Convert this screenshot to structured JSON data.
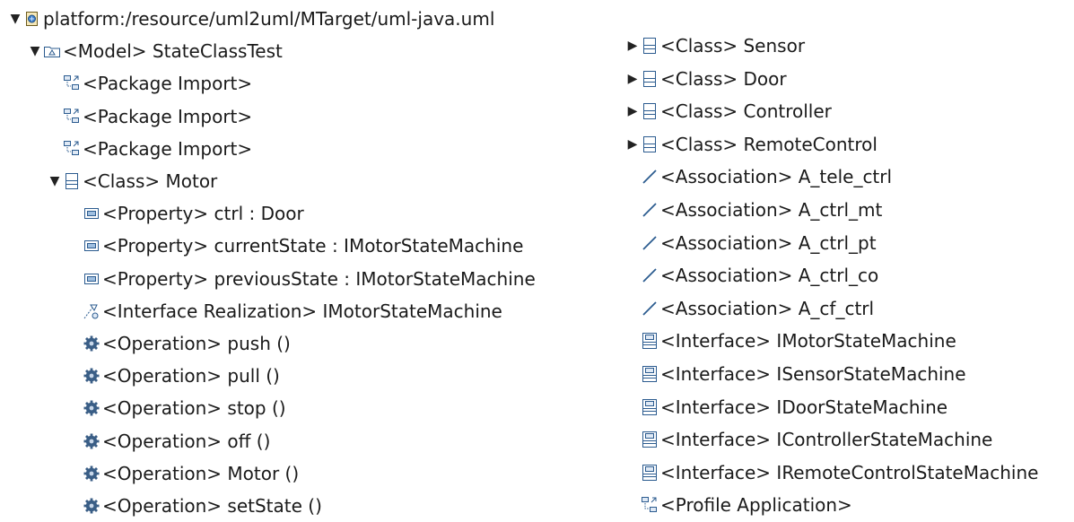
{
  "left_tree": [
    {
      "label": "platform:/resource/uml2uml/MTarget/uml-java.uml",
      "icon": "resource-icon",
      "twisty": "expanded",
      "level": 0
    },
    {
      "label": "<Model> StateClassTest",
      "icon": "model-icon",
      "twisty": "expanded",
      "level": 1
    },
    {
      "label": "<Package Import>",
      "icon": "package-import-icon",
      "twisty": "none",
      "level": 2
    },
    {
      "label": "<Package Import>",
      "icon": "package-import-icon",
      "twisty": "none",
      "level": 2
    },
    {
      "label": "<Package Import>",
      "icon": "package-import-icon",
      "twisty": "none",
      "level": 2
    },
    {
      "label": "<Class> Motor",
      "icon": "class-icon",
      "twisty": "expanded",
      "level": 2
    },
    {
      "label": "<Property> ctrl : Door",
      "icon": "property-icon",
      "twisty": "none",
      "level": 3
    },
    {
      "label": "<Property> currentState : IMotorStateMachine",
      "icon": "property-icon",
      "twisty": "none",
      "level": 3
    },
    {
      "label": "<Property> previousState : IMotorStateMachine",
      "icon": "property-icon",
      "twisty": "none",
      "level": 3
    },
    {
      "label": "<Interface Realization> IMotorStateMachine",
      "icon": "interface-realization-icon",
      "twisty": "none",
      "level": 3
    },
    {
      "label": "<Operation> push ()",
      "icon": "operation-icon",
      "twisty": "none",
      "level": 3
    },
    {
      "label": "<Operation> pull ()",
      "icon": "operation-icon",
      "twisty": "none",
      "level": 3
    },
    {
      "label": "<Operation> stop ()",
      "icon": "operation-icon",
      "twisty": "none",
      "level": 3
    },
    {
      "label": "<Operation> off ()",
      "icon": "operation-icon",
      "twisty": "none",
      "level": 3
    },
    {
      "label": "<Operation> Motor ()",
      "icon": "operation-icon",
      "twisty": "none",
      "level": 3
    },
    {
      "label": "<Operation> setState ()",
      "icon": "operation-icon",
      "twisty": "none",
      "level": 3
    }
  ],
  "right_tree": [
    {
      "label": "<Class> Sensor",
      "icon": "class-icon",
      "twisty": "collapsed",
      "level": 0
    },
    {
      "label": "<Class> Door",
      "icon": "class-icon",
      "twisty": "collapsed",
      "level": 0
    },
    {
      "label": "<Class> Controller",
      "icon": "class-icon",
      "twisty": "collapsed",
      "level": 0
    },
    {
      "label": "<Class> RemoteControl",
      "icon": "class-icon",
      "twisty": "collapsed",
      "level": 0
    },
    {
      "label": "<Association> A_tele_ctrl",
      "icon": "association-icon",
      "twisty": "none",
      "level": 0
    },
    {
      "label": "<Association> A_ctrl_mt",
      "icon": "association-icon",
      "twisty": "none",
      "level": 0
    },
    {
      "label": "<Association> A_ctrl_pt",
      "icon": "association-icon",
      "twisty": "none",
      "level": 0
    },
    {
      "label": "<Association> A_ctrl_co",
      "icon": "association-icon",
      "twisty": "none",
      "level": 0
    },
    {
      "label": "<Association> A_cf_ctrl",
      "icon": "association-icon",
      "twisty": "none",
      "level": 0
    },
    {
      "label": "<Interface> IMotorStateMachine",
      "icon": "interface-icon",
      "twisty": "none",
      "level": 0
    },
    {
      "label": "<Interface> ISensorStateMachine",
      "icon": "interface-icon",
      "twisty": "none",
      "level": 0
    },
    {
      "label": "<Interface> IDoorStateMachine",
      "icon": "interface-icon",
      "twisty": "none",
      "level": 0
    },
    {
      "label": "<Interface> IControllerStateMachine",
      "icon": "interface-icon",
      "twisty": "none",
      "level": 0
    },
    {
      "label": "<Interface> IRemoteControlStateMachine",
      "icon": "interface-icon",
      "twisty": "none",
      "level": 0
    },
    {
      "label": "<Profile Application>",
      "icon": "profile-application-icon",
      "twisty": "none",
      "level": 0
    }
  ]
}
